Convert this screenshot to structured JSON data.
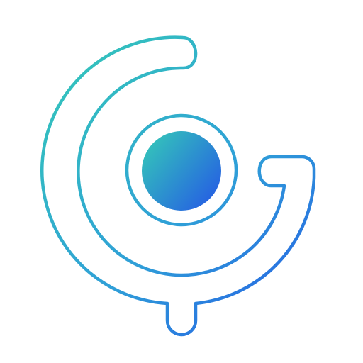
{
  "logo": {
    "name": "g-letter-logo-icon",
    "colors": {
      "gradient_start": "#34c7b9",
      "gradient_mid": "#2f9fd8",
      "gradient_end": "#2457e6",
      "background": "#ffffff"
    }
  }
}
